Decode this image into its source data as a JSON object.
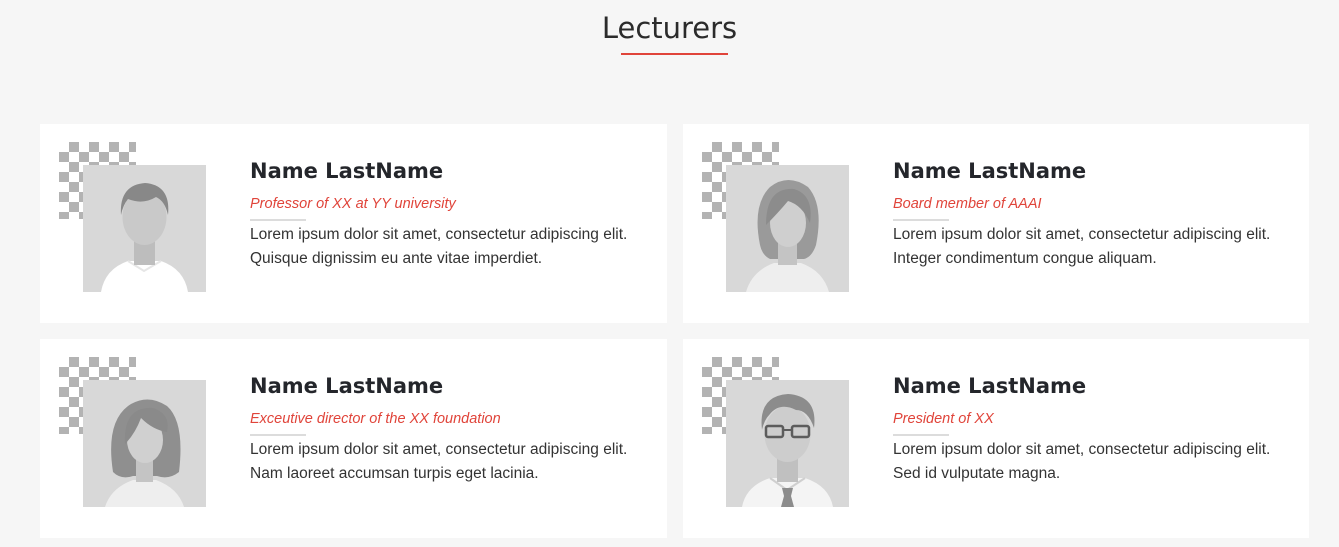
{
  "section": {
    "title": "Lecturers",
    "accent_color": "#e0443a"
  },
  "lecturers": [
    {
      "avatar_icon": "male-avatar-icon",
      "name": "Name LastName",
      "role": "Professor of XX at YY university",
      "description": "Lorem ipsum dolor sit amet, consectetur adipiscing elit. Quisque dignissim eu ante vitae imperdiet."
    },
    {
      "avatar_icon": "female-avatar-icon",
      "name": "Name LastName",
      "role": "Board member of AAAI",
      "description": "Lorem ipsum dolor sit amet, consectetur adipiscing elit. Integer condimentum congue aliquam."
    },
    {
      "avatar_icon": "female-bob-avatar-icon",
      "name": "Name LastName",
      "role": "Exceutive director of the XX foundation",
      "description": "Lorem ipsum dolor sit amet, consectetur adipiscing elit. Nam laoreet accumsan turpis eget lacinia."
    },
    {
      "avatar_icon": "male-glasses-avatar-icon",
      "name": "Name LastName",
      "role": "President of XX",
      "description": "Lorem ipsum dolor sit amet, consectetur adipiscing elit. Sed id vulputate magna."
    }
  ]
}
